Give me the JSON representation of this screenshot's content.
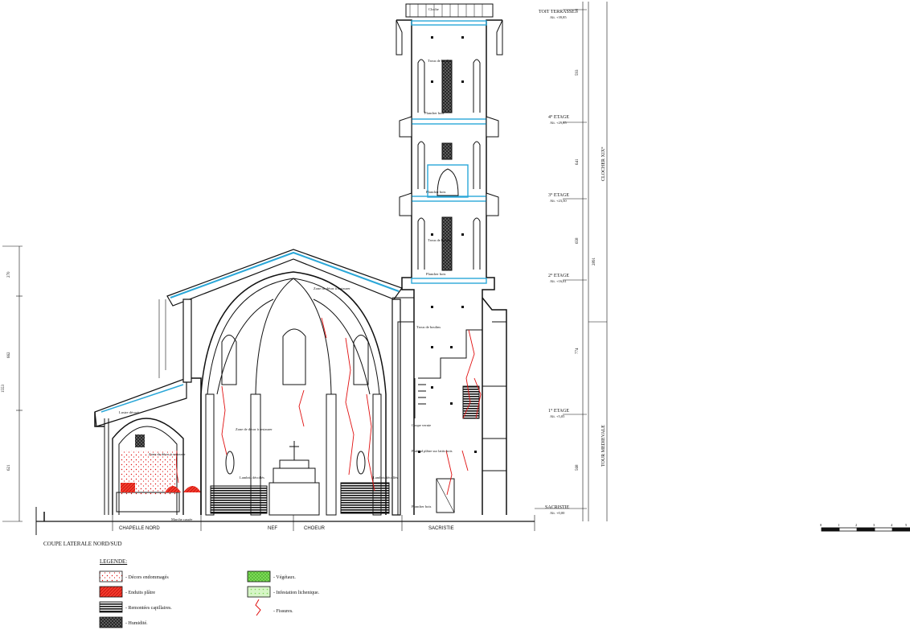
{
  "drawing_title": "COUPE LATERALE NORD/SUD",
  "zones": {
    "chapelle_nord": "CHAPELLE NORD",
    "nef": "NEF",
    "choeur": "CHOEUR",
    "sacristie": "SACRISTIE"
  },
  "levels": [
    {
      "name": "TOIT TERRASSE",
      "alt": "Alt. +39,85"
    },
    {
      "name": "4° ETAGE",
      "alt": "Alt. +29,85"
    },
    {
      "name": "3° ETAGE",
      "alt": "Alt. +23,50"
    },
    {
      "name": "2° ETAGE",
      "alt": "Alt. +16,61"
    },
    {
      "name": "1° ETAGE",
      "alt": "Alt. +5,05"
    },
    {
      "name": "SACRISTIE",
      "alt": "Alt. +0,00"
    }
  ],
  "tower_labels": {
    "upper": "CLOCHER XIX°",
    "lower": "TOUR MEDIEVALE"
  },
  "right_dimensions": [
    "98",
    "593",
    "641",
    "658",
    "2891",
    "774",
    "568"
  ],
  "left_dimensions": [
    "270",
    "662",
    "1553",
    "621"
  ],
  "annotations": {
    "trous_boulin_1": "Trous de boulins",
    "plancher_1": "Plancher bois",
    "plancher_2": "Plancher bois",
    "trous_boulin_2": "Trous de boulins",
    "trous_boulin_3": "Trous de boulins",
    "plancher_3": "Plancher bois",
    "plancher_4": "Plancher bois",
    "plafond": "Plafond plâtre sur lattis bois",
    "coupe_vernie": "Coupe vernie",
    "zone_decor_top": "Zone de décor à restaurer",
    "zone_decor_nef": "Zone de décor à restaurer",
    "zone_decor_chap": "Zone de décor à restaurer",
    "lustre_chap": "Lustre décoré",
    "lambris_1": "Lambris décollés",
    "lambris_2": "Lambris décollés",
    "marche": "Marche cassée",
    "plancher_bas": "Plancher bois",
    "cloche": "Cloche"
  },
  "legend": {
    "title": "LEGENDE:",
    "items": [
      {
        "label": "- Décors endommagés",
        "swatch": "dots-red"
      },
      {
        "label": "- Enduits plâtre",
        "swatch": "hatch-red"
      },
      {
        "label": "- Remontées capillaires.",
        "swatch": "stripes-black"
      },
      {
        "label": "- Humidité.",
        "swatch": "cross-black"
      },
      {
        "label": "- Végétaux.",
        "swatch": "green-grid"
      },
      {
        "label": "- Infestation lichenique.",
        "swatch": "green-light"
      },
      {
        "label": "- Fissures.",
        "swatch": "red-line"
      }
    ]
  },
  "scale_bar": {
    "ticks": [
      "0",
      "1",
      "2",
      "3",
      "4",
      "5"
    ]
  },
  "colors": {
    "line": "#111111",
    "crack": "#e01010",
    "steel": "#2aa7d8",
    "green": "#7ed957",
    "red_fill": "#e8201c"
  }
}
